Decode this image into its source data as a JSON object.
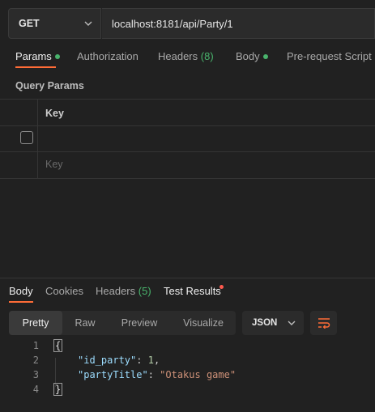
{
  "request": {
    "method": "GET",
    "url": "localhost:8181/api/Party/1"
  },
  "request_tabs": {
    "params": "Params",
    "authorization": "Authorization",
    "headers": "Headers",
    "headers_count": "(8)",
    "body": "Body",
    "prerequest": "Pre-request Script"
  },
  "query_params": {
    "title": "Query Params",
    "column_key": "Key",
    "key_placeholder": "Key"
  },
  "response_tabs": {
    "body": "Body",
    "cookies": "Cookies",
    "headers": "Headers",
    "headers_count": "(5)",
    "test_results": "Test Results"
  },
  "view_modes": {
    "pretty": "Pretty",
    "raw": "Raw",
    "preview": "Preview",
    "visualize": "Visualize"
  },
  "format": "JSON",
  "code": {
    "line_numbers": [
      "1",
      "2",
      "3",
      "4"
    ],
    "open_brace": "{",
    "close_brace": "}",
    "key1": "\"id_party\"",
    "colon": ": ",
    "val1": "1",
    "comma": ",",
    "key2": "\"partyTitle\"",
    "val2": "\"Otakus game\""
  },
  "colors": {
    "accent": "#ff6c37",
    "status_green": "#49b36c",
    "status_red": "#ff5a4e"
  }
}
